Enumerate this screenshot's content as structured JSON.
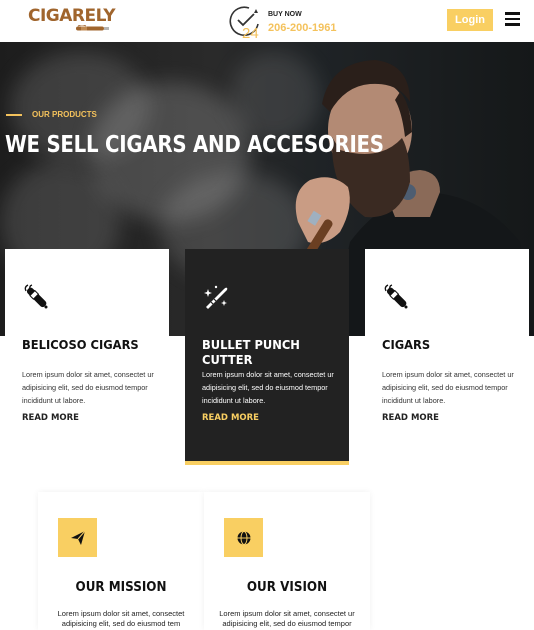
{
  "header": {
    "logo_text": "CIGARELY",
    "buy_now": "BUY NOW",
    "phone": "206-200-1961",
    "login_label": "Login"
  },
  "hero": {
    "eyebrow": "OUR PRODUCTS",
    "title": "WE SELL CIGARS AND ACCESORIES"
  },
  "cards": [
    {
      "title": "BELICOSO CIGARS",
      "text": "Lorem ipsum dolor sit amet, consectet ur adipisicing elit, sed do eiusmod tempor incididunt ut labore.",
      "link": "READ MORE",
      "icon": "cigar-icon"
    },
    {
      "title": "BULLET PUNCH CUTTER",
      "text": "Lorem ipsum dolor sit amet, consectet ur adipisicing elit, sed do eiusmod tempor incididunt ut labore.",
      "link": "READ MORE",
      "icon": "bullet-cutter-icon"
    },
    {
      "title": "CIGARS",
      "text": "Lorem ipsum dolor sit amet, consectet ur adipisicing elit, sed do eiusmod tempor incididunt ut labore.",
      "link": "READ MORE",
      "icon": "cigar-icon"
    }
  ],
  "mission": {
    "title": "OUR MISSION",
    "text_line1": "Lorem ipsum dolor sit amet, consectet",
    "text_line2": "adipisicing elit, sed do eiusmod tem",
    "icon": "paper-plane-icon"
  },
  "vision": {
    "title": "OUR VISION",
    "text_line1": "Lorem ipsum dolor sit amet, consectet ur",
    "text_line2": "adipisicing elit, sed do eiusmod tempor",
    "icon": "globe-icon"
  },
  "colors": {
    "accent": "#f9cf62",
    "brand_brown": "#a0652d",
    "dark_card": "#222222"
  }
}
